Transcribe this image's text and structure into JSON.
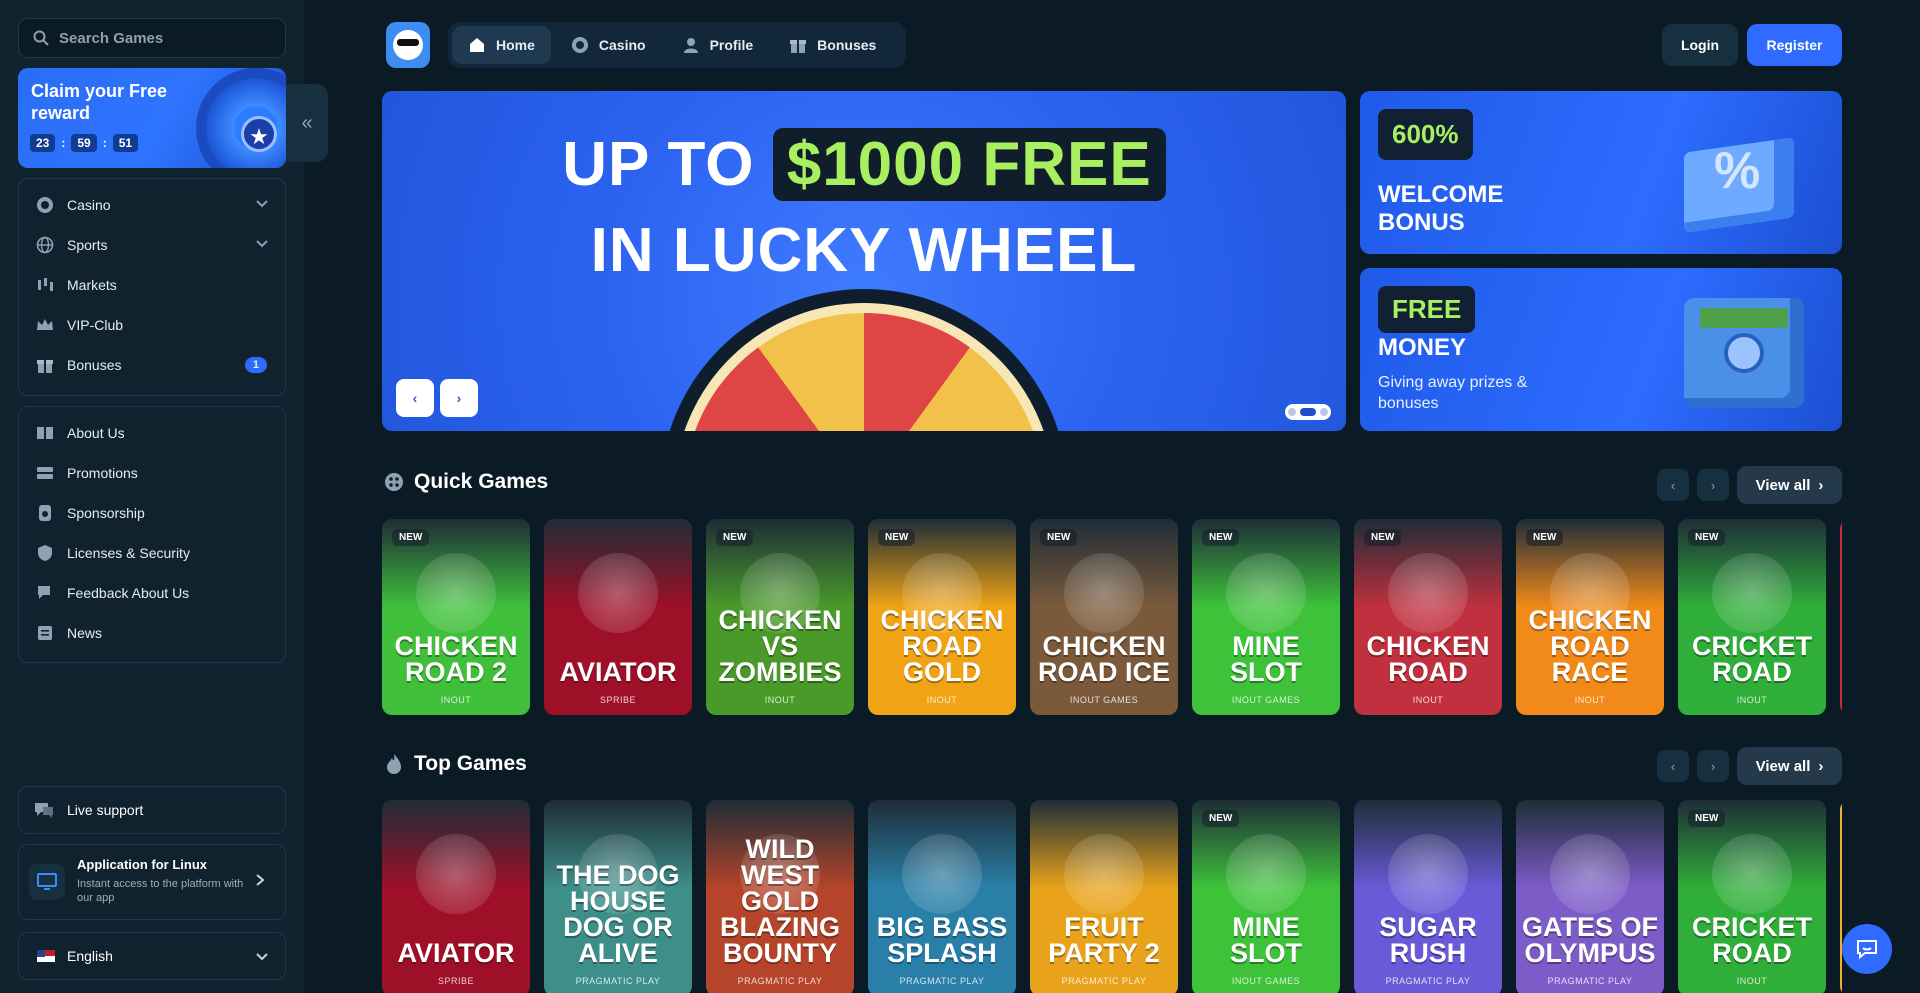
{
  "sidebar": {
    "search_placeholder": "Search Games",
    "reward": {
      "title": "Claim your Free reward",
      "hours": "23",
      "minutes": "59",
      "seconds": "51"
    },
    "primary": [
      {
        "label": "Casino",
        "icon": "casino-chip-icon",
        "chevron": true
      },
      {
        "label": "Sports",
        "icon": "globe-icon",
        "chevron": true
      },
      {
        "label": "Markets",
        "icon": "candles-icon"
      },
      {
        "label": "VIP-Club",
        "icon": "crown-icon"
      },
      {
        "label": "Bonuses",
        "icon": "gift-icon",
        "badge": "1"
      }
    ],
    "secondary": [
      {
        "label": "About Us",
        "icon": "book-icon"
      },
      {
        "label": "Promotions",
        "icon": "tickets-icon"
      },
      {
        "label": "Sponsorship",
        "icon": "medal-icon"
      },
      {
        "label": "Licenses & Security",
        "icon": "shield-icon"
      },
      {
        "label": "Feedback About Us",
        "icon": "chat-bubble-icon"
      },
      {
        "label": "News",
        "icon": "newspaper-icon"
      }
    ],
    "live_support": "Live support",
    "app": {
      "title": "Application for Linux",
      "subtitle": "Instant access to the platform with our app"
    },
    "language": "English"
  },
  "topnav": {
    "tabs": [
      {
        "label": "Home",
        "icon": "home-icon",
        "active": true
      },
      {
        "label": "Casino",
        "icon": "casino-chip-icon"
      },
      {
        "label": "Profile",
        "icon": "user-icon"
      },
      {
        "label": "Bonuses",
        "icon": "gift-icon"
      }
    ],
    "login": "Login",
    "register": "Register"
  },
  "hero": {
    "line1_prefix": "UP TO",
    "line1_highlight": "$1000 FREE",
    "line2": "IN LUCKY WHEEL"
  },
  "promos": {
    "welcome": {
      "tag": "600%",
      "title": "WELCOME BONUS"
    },
    "free": {
      "tag": "FREE",
      "title": "MONEY",
      "subtitle": "Giving away prizes & bonuses"
    }
  },
  "quick_games": {
    "title": "Quick Games",
    "view_all": "View all",
    "games": [
      {
        "name": "CHICKEN ROAD 2",
        "provider": "INOUT",
        "new": true,
        "color": "#3fbf3a"
      },
      {
        "name": "AVIATOR",
        "provider": "SPRIBE",
        "new": false,
        "color": "#9e1028"
      },
      {
        "name": "CHICKEN VS ZOMBIES",
        "provider": "INOUT",
        "new": true,
        "color": "#4a9a2a"
      },
      {
        "name": "CHICKEN ROAD GOLD",
        "provider": "INOUT",
        "new": true,
        "color": "#f0a415"
      },
      {
        "name": "CHICKEN ROAD ICE",
        "provider": "INOUT GAMES",
        "new": true,
        "color": "#7a5a3a"
      },
      {
        "name": "MINE SLOT",
        "provider": "INOUT GAMES",
        "new": true,
        "color": "#3ec23a"
      },
      {
        "name": "CHICKEN ROAD",
        "provider": "INOUT",
        "new": true,
        "color": "#c0303e"
      },
      {
        "name": "CHICKEN ROAD RACE",
        "provider": "INOUT",
        "new": true,
        "color": "#f28a1a"
      },
      {
        "name": "CRICKET ROAD",
        "provider": "INOUT",
        "new": true,
        "color": "#2fae3a"
      }
    ]
  },
  "top_games": {
    "title": "Top Games",
    "view_all": "View all",
    "games": [
      {
        "name": "AVIATOR",
        "provider": "SPRIBE",
        "new": false,
        "color": "#9e1028"
      },
      {
        "name": "THE DOG HOUSE DOG OR ALIVE",
        "provider": "PRAGMATIC PLAY",
        "new": false,
        "color": "#3e8f8a"
      },
      {
        "name": "WILD WEST GOLD BLAZING BOUNTY",
        "provider": "PRAGMATIC PLAY",
        "new": false,
        "color": "#b5442a"
      },
      {
        "name": "BIG BASS SPLASH",
        "provider": "PRAGMATIC PLAY",
        "new": false,
        "color": "#2a7fa8"
      },
      {
        "name": "FRUIT PARTY 2",
        "provider": "PRAGMATIC PLAY",
        "new": false,
        "color": "#e8a31a"
      },
      {
        "name": "MINE SLOT",
        "provider": "INOUT GAMES",
        "new": true,
        "color": "#3ec23a"
      },
      {
        "name": "SUGAR RUSH",
        "provider": "PRAGMATIC PLAY",
        "new": false,
        "color": "#6a5ad8"
      },
      {
        "name": "GATES OF OLYMPUS",
        "provider": "PRAGMATIC PLAY",
        "new": false,
        "color": "#7d5cc8"
      },
      {
        "name": "CRICKET ROAD",
        "provider": "INOUT",
        "new": true,
        "color": "#2fae3a"
      }
    ]
  },
  "colors": {
    "accent": "#2f6bff",
    "highlight": "#a8f060",
    "background": "#0b1b26"
  }
}
